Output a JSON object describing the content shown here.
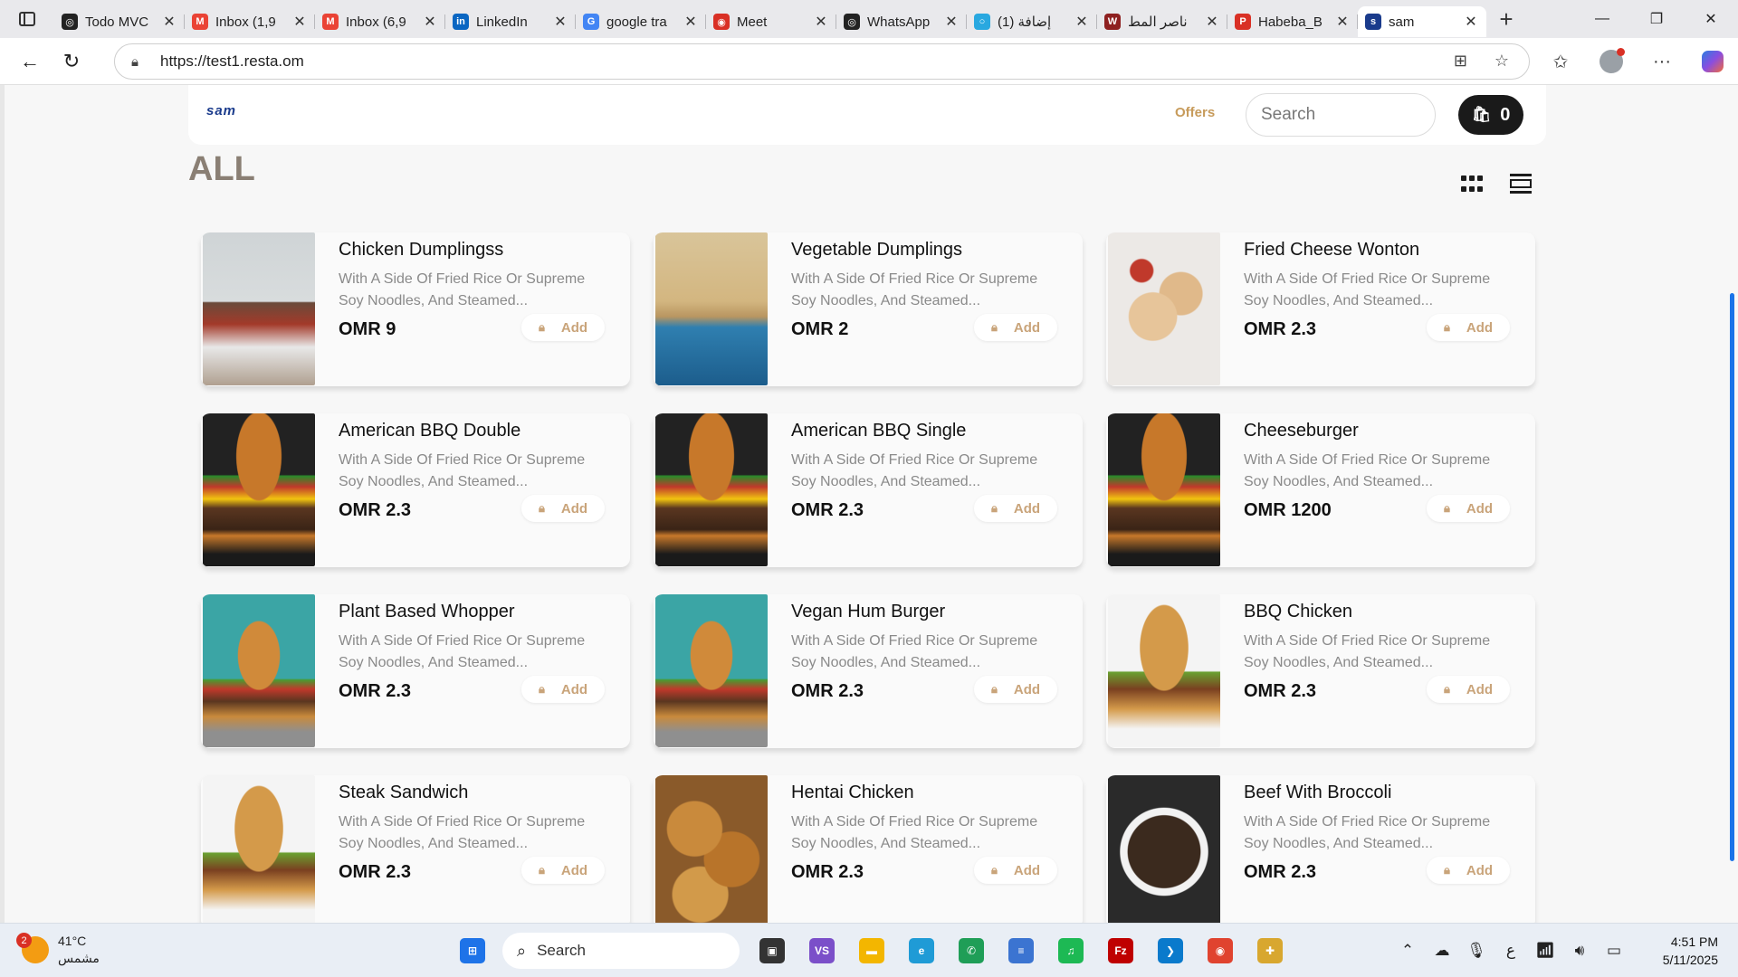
{
  "browser": {
    "tabs": [
      {
        "title": "Todo MVC",
        "favicon_color": "#222222",
        "favicon_glyph": "◎",
        "active": false
      },
      {
        "title": "Inbox (1,9",
        "favicon_color": "#ea4335",
        "favicon_glyph": "M",
        "active": false
      },
      {
        "title": "Inbox (6,9",
        "favicon_color": "#ea4335",
        "favicon_glyph": "M",
        "active": false
      },
      {
        "title": "LinkedIn",
        "favicon_color": "#0a66c2",
        "favicon_glyph": "in",
        "active": false
      },
      {
        "title": "google tra",
        "favicon_color": "#4285f4",
        "favicon_glyph": "G",
        "active": false
      },
      {
        "title": "Meet",
        "favicon_color": "#d93025",
        "favicon_glyph": "◉",
        "active": false
      },
      {
        "title": "WhatsApp",
        "favicon_color": "#222222",
        "favicon_glyph": "◎",
        "active": false
      },
      {
        "title": "(1) إضافة",
        "favicon_color": "#29a8e0",
        "favicon_glyph": "○",
        "active": false
      },
      {
        "title": "ناصر المط",
        "favicon_color": "#8e2020",
        "favicon_glyph": "W",
        "active": false
      },
      {
        "title": "Habeba_B",
        "favicon_color": "#d93025",
        "favicon_glyph": "P",
        "active": false
      },
      {
        "title": "sam",
        "favicon_color": "#1a3b8c",
        "favicon_glyph": "s",
        "active": true
      }
    ],
    "url": "https://test1.resta.om"
  },
  "site": {
    "logo": "sam",
    "nav_offers": "Offers",
    "search_placeholder": "Search",
    "cart_count": "0",
    "page_title": "ALL",
    "add_label": "Add"
  },
  "products": [
    {
      "name": "Chicken Dumplingss",
      "desc_line1": "With A Side Of Fried Rice Or Supreme",
      "desc_line2": "Soy Noodles, And Steamed...",
      "price": "OMR 9",
      "thumb": "t-room"
    },
    {
      "name": "Vegetable Dumplings",
      "desc_line1": "With A Side Of Fried Rice Or Supreme",
      "desc_line2": "Soy Noodles, And Steamed...",
      "price": "OMR 2",
      "thumb": "t-sea"
    },
    {
      "name": "Fried Cheese Wonton",
      "desc_line1": "With A Side Of Fried Rice Or Supreme",
      "desc_line2": "Soy Noodles, And Steamed...",
      "price": "OMR 2.3",
      "thumb": "t-wonton"
    },
    {
      "name": "American BBQ Double",
      "desc_line1": "With A Side Of Fried Rice Or Supreme",
      "desc_line2": "Soy Noodles, And Steamed...",
      "price": "OMR 2.3",
      "thumb": "t-burger"
    },
    {
      "name": "American BBQ Single",
      "desc_line1": "With A Side Of Fried Rice Or Supreme",
      "desc_line2": "Soy Noodles, And Steamed...",
      "price": "OMR 2.3",
      "thumb": "t-burger"
    },
    {
      "name": "Cheeseburger",
      "desc_line1": "With A Side Of Fried Rice Or Supreme",
      "desc_line2": "Soy Noodles, And Steamed...",
      "price": "OMR 1200",
      "thumb": "t-burger"
    },
    {
      "name": "Plant Based Whopper",
      "desc_line1": "With A Side Of Fried Rice Or Supreme",
      "desc_line2": "Soy Noodles, And Steamed...",
      "price": "OMR 2.3",
      "thumb": "t-whopper"
    },
    {
      "name": "Vegan Hum Burger",
      "desc_line1": "With A Side Of Fried Rice Or Supreme",
      "desc_line2": "Soy Noodles, And Steamed...",
      "price": "OMR 2.3",
      "thumb": "t-whopper"
    },
    {
      "name": "BBQ Chicken",
      "desc_line1": "With A Side Of Fried Rice Or Supreme",
      "desc_line2": "Soy Noodles, And Steamed...",
      "price": "OMR 2.3",
      "thumb": "t-bbq"
    },
    {
      "name": "Steak Sandwich",
      "desc_line1": "With A Side Of Fried Rice Or Supreme",
      "desc_line2": "Soy Noodles, And Steamed...",
      "price": "OMR 2.3",
      "thumb": "t-bbq"
    },
    {
      "name": "Hentai Chicken",
      "desc_line1": "With A Side Of Fried Rice Or Supreme",
      "desc_line2": "Soy Noodles, And Steamed...",
      "price": "OMR 2.3",
      "thumb": "t-fried"
    },
    {
      "name": "Beef With Broccoli",
      "desc_line1": "With A Side Of Fried Rice Or Supreme",
      "desc_line2": "Soy Noodles, And Steamed...",
      "price": "OMR 2.3",
      "thumb": "t-beef"
    }
  ],
  "taskbar": {
    "weather_temp": "41°C",
    "weather_desc": "مشمس",
    "weather_badge": "2",
    "search_label": "Search",
    "apps": [
      {
        "icon": "windows-start-icon",
        "color": "#1e73e8",
        "glyph": "⊞"
      },
      {
        "icon": "task-view-icon",
        "color": "#333333",
        "glyph": "▣"
      },
      {
        "icon": "visual-studio-icon",
        "color": "#7b4fc9",
        "glyph": "VS"
      },
      {
        "icon": "file-explorer-icon",
        "color": "#f3b600",
        "glyph": "▬"
      },
      {
        "icon": "edge-icon",
        "color": "#1f9bd6",
        "glyph": "e"
      },
      {
        "icon": "whatsapp-icon",
        "color": "#1f9e57",
        "glyph": "✆"
      },
      {
        "icon": "notepad-icon",
        "color": "#3b74d1",
        "glyph": "≡"
      },
      {
        "icon": "spotify-icon",
        "color": "#1db954",
        "glyph": "♫"
      },
      {
        "icon": "filezilla-icon",
        "color": "#bf0000",
        "glyph": "Fz"
      },
      {
        "icon": "vscode-icon",
        "color": "#0a7acc",
        "glyph": "❯"
      },
      {
        "icon": "chrome-icon",
        "color": "#e0432f",
        "glyph": "◉"
      },
      {
        "icon": "tools-icon",
        "color": "#d8a72f",
        "glyph": "✚"
      }
    ],
    "tray_lang": "ع",
    "time": "4:51 PM",
    "date": "5/11/2025"
  }
}
